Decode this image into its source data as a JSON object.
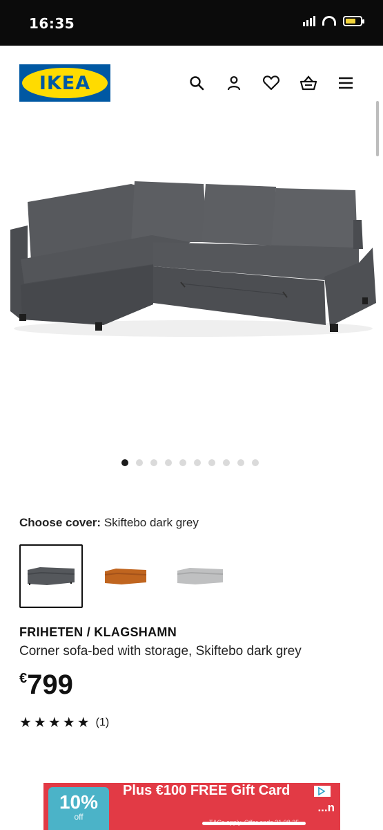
{
  "status": {
    "time": "16:35"
  },
  "header": {
    "logo": "IKEA",
    "icons": [
      "search-icon",
      "profile-icon",
      "heart-icon",
      "basket-icon",
      "menu-icon"
    ]
  },
  "gallery": {
    "dots_total": 10,
    "active_index": 0
  },
  "cover": {
    "label": "Choose cover:",
    "value": "Skiftebo dark grey",
    "options": [
      {
        "color": "#55585c",
        "selected": true
      },
      {
        "color": "#c0651f",
        "selected": false
      },
      {
        "color": "#bfc0c1",
        "selected": false
      }
    ]
  },
  "product": {
    "name": "FRIHETEN / KLAGSHAMN",
    "description": "Corner sofa-bed with storage, Skiftebo dark grey",
    "currency": "€",
    "price": "799",
    "stars": "★★★★★",
    "reviews": "(1)"
  },
  "ad": {
    "badge_pct": "10%",
    "badge_off": "off",
    "title": "Plus €100 FREE Gift Card",
    "more": "...n",
    "fine_print": "T&Cs apply. Offer ends 31.08.25"
  }
}
